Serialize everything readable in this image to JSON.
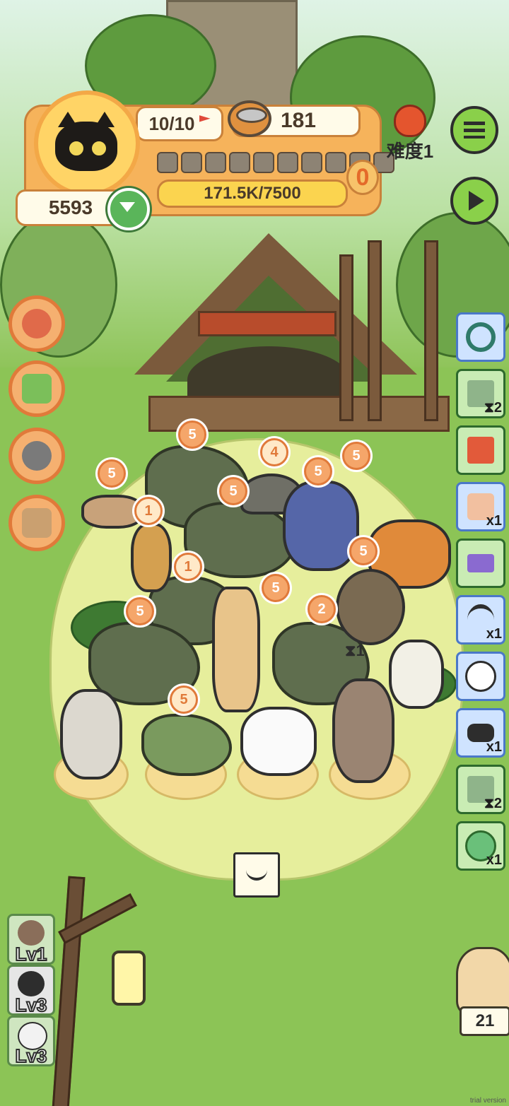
{
  "hud": {
    "level_progress": "10/10",
    "food_count": "181",
    "difficulty": "难度1",
    "score": "5593",
    "segment_count": 10,
    "xp_text": "171.5K/7500",
    "alert_count": "0"
  },
  "left_buttons": [
    "cat-mascot-icon",
    "guidebook-icon",
    "food-bowl-icon",
    "box-icon"
  ],
  "right_items": [
    {
      "icon": "ring-icon",
      "count": "",
      "style": "blue"
    },
    {
      "icon": "fence-icon",
      "count": "2",
      "style": "green",
      "hourglass": true
    },
    {
      "icon": "ticket-icon",
      "count": "",
      "style": "green"
    },
    {
      "icon": "candle-cake-icon",
      "count": "x1",
      "style": "blue"
    },
    {
      "icon": "card-icon",
      "count": "",
      "style": "green"
    },
    {
      "icon": "scythe-icon",
      "count": "x1",
      "style": "blue"
    },
    {
      "icon": "sheep-icon",
      "count": "",
      "style": "blue"
    },
    {
      "icon": "binoculars-icon",
      "count": "x1",
      "style": "blue"
    },
    {
      "icon": "fence-icon",
      "count": "2",
      "style": "green",
      "hourglass": true
    },
    {
      "icon": "lollipop-icon",
      "count": "x1",
      "style": "green"
    }
  ],
  "badges": [
    "5",
    "4",
    "5",
    "5",
    "5",
    "5",
    "1",
    "1",
    "5",
    "5",
    "5",
    "2",
    "5"
  ],
  "hourglass_badge": "1",
  "levels": [
    "Lv1",
    "Lv3",
    "Lv3"
  ],
  "owl_count": "21",
  "watermark": "trial version",
  "colors": {
    "accent": "#f6b35b",
    "button_green": "#8ad04a",
    "grass": "#8cc456"
  }
}
